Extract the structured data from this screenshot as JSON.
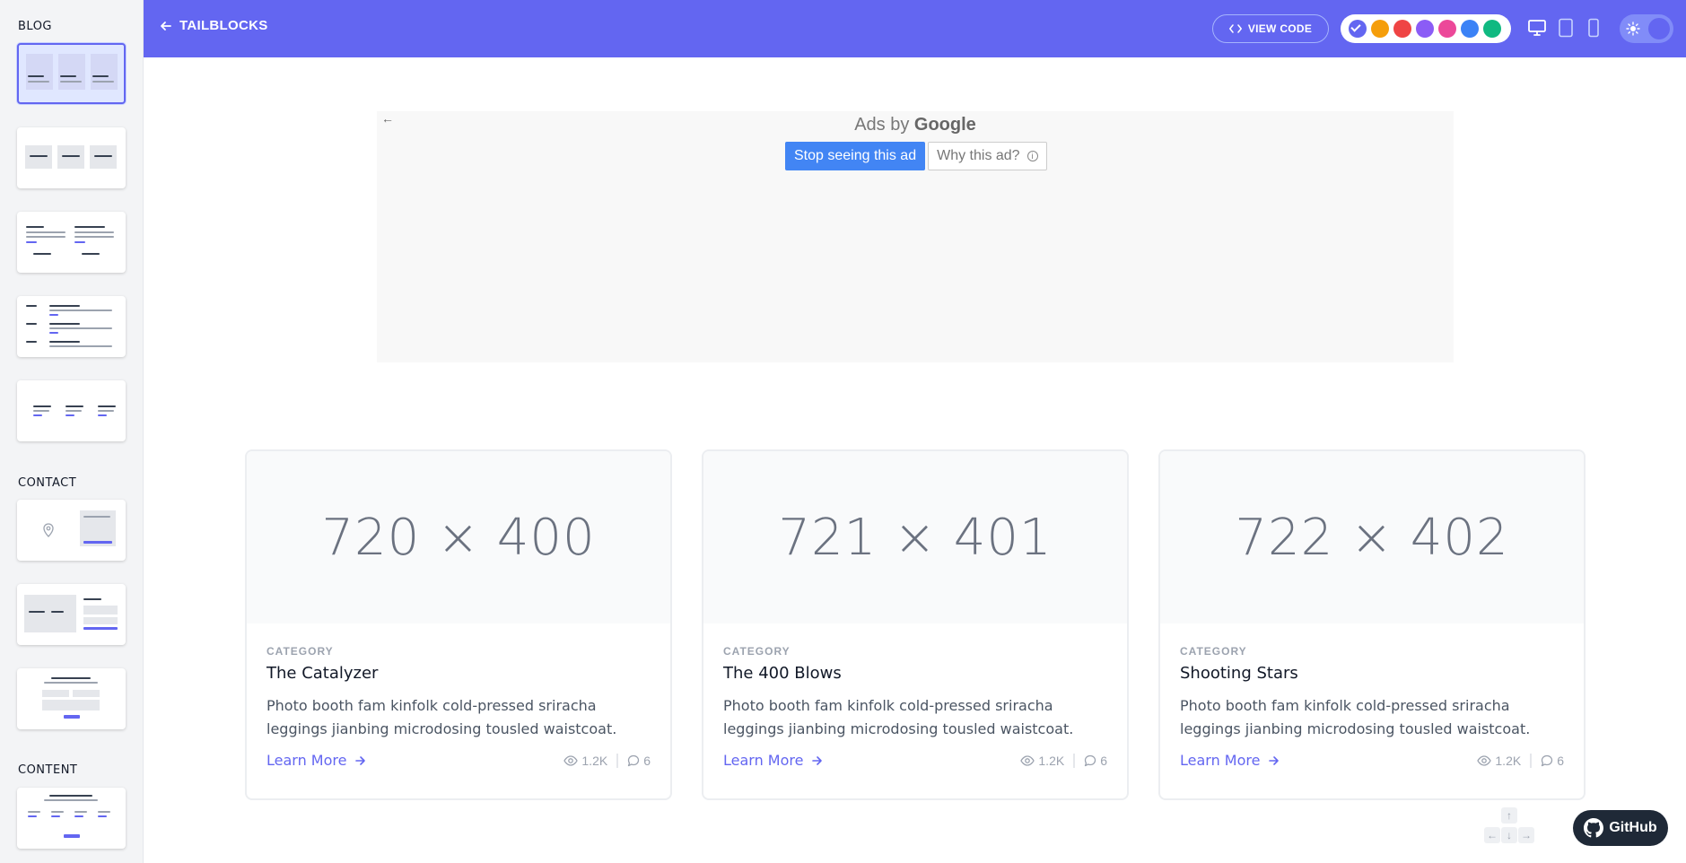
{
  "sidebar": {
    "sections": [
      {
        "label": "BLOG"
      },
      {
        "label": "CONTACT"
      },
      {
        "label": "CONTENT"
      }
    ]
  },
  "header": {
    "back_label": "TAILBLOCKS",
    "view_code_label": "VIEW CODE",
    "swatches": [
      {
        "name": "indigo",
        "color": "#6366f1",
        "selected": true
      },
      {
        "name": "yellow",
        "color": "#f59e0b",
        "selected": false
      },
      {
        "name": "red",
        "color": "#ef4444",
        "selected": false
      },
      {
        "name": "purple",
        "color": "#8b5cf6",
        "selected": false
      },
      {
        "name": "pink",
        "color": "#ec4899",
        "selected": false
      },
      {
        "name": "blue",
        "color": "#3b82f6",
        "selected": false
      },
      {
        "name": "green",
        "color": "#10b981",
        "selected": false
      }
    ]
  },
  "ad": {
    "ads_by": "Ads by",
    "brand": "Google",
    "stop_label": "Stop seeing this ad",
    "why_label": "Why this ad?"
  },
  "cards": [
    {
      "image": "720 × 400",
      "category": "CATEGORY",
      "title": "The Catalyzer",
      "description": "Photo booth fam kinfolk cold-pressed sriracha leggings jianbing microdosing tousled waistcoat.",
      "link": "Learn More",
      "views": "1.2K",
      "comments": "6"
    },
    {
      "image": "721 × 401",
      "category": "CATEGORY",
      "title": "The 400 Blows",
      "description": "Photo booth fam kinfolk cold-pressed sriracha leggings jianbing microdosing tousled waistcoat.",
      "link": "Learn More",
      "views": "1.2K",
      "comments": "6"
    },
    {
      "image": "722 × 402",
      "category": "CATEGORY",
      "title": "Shooting Stars",
      "description": "Photo booth fam kinfolk cold-pressed sriracha leggings jianbing microdosing tousled waistcoat.",
      "link": "Learn More",
      "views": "1.2K",
      "comments": "6"
    }
  ],
  "github_label": "GitHub",
  "colors": {
    "accent": "#6366f1",
    "dark": "#1f2937"
  }
}
